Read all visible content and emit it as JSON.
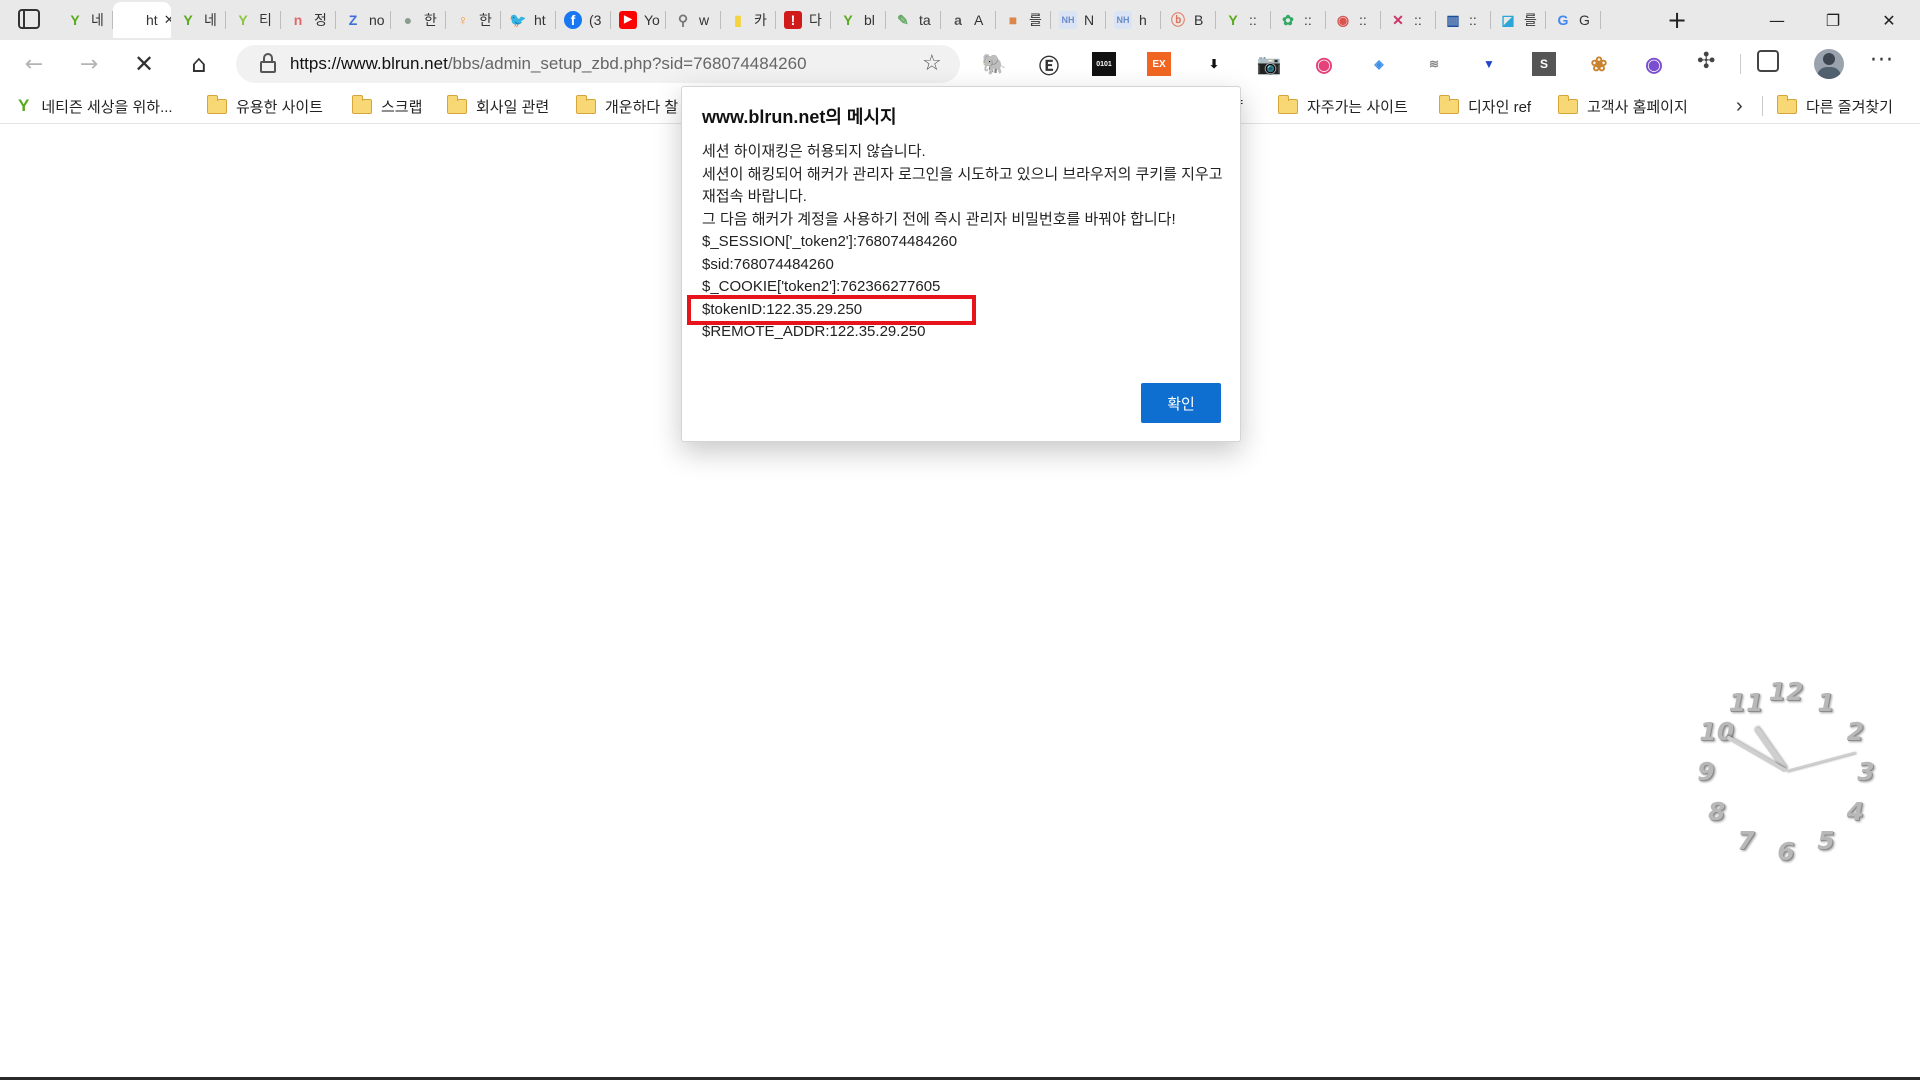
{
  "browser": {
    "tabs": [
      {
        "label": "네",
        "icon": "naver-blog-icon",
        "color": "#5aaa1e",
        "glyph": "Y"
      },
      {
        "label": "ht",
        "icon": "blank-page-icon",
        "color": "#ffffff",
        "glyph": "",
        "active": true,
        "close": "✕"
      },
      {
        "label": "네",
        "icon": "naver-blog-icon",
        "color": "#5aaa1e",
        "glyph": "Y"
      },
      {
        "label": "티",
        "icon": "naver-blog-icon",
        "color": "#8cc63f",
        "glyph": "Y"
      },
      {
        "label": "정",
        "icon": "n-icon",
        "color": "#e0686b",
        "glyph": "n"
      },
      {
        "label": "no",
        "icon": "z-icon",
        "color": "#3e6fd8",
        "glyph": "Z"
      },
      {
        "label": "한",
        "icon": "person-icon",
        "color": "#8c9c8c",
        "glyph": "●"
      },
      {
        "label": "한",
        "icon": "figure-icon",
        "color": "#f39a33",
        "glyph": "♀"
      },
      {
        "label": "ht",
        "icon": "twitter-icon",
        "color": "#1d9bf0",
        "glyph": "🐦"
      },
      {
        "label": "(3",
        "icon": "facebook-icon",
        "color": "#1877f2",
        "glyph": "f"
      },
      {
        "label": "Yo",
        "icon": "youtube-icon",
        "color": "#ff0000",
        "glyph": "▶"
      },
      {
        "label": "w",
        "icon": "link-icon",
        "color": "#777777",
        "glyph": "⚲"
      },
      {
        "label": "카",
        "icon": "note-icon",
        "color": "#f5d33f",
        "glyph": "▮"
      },
      {
        "label": "다",
        "icon": "exclaim-icon",
        "color": "#d11a1a",
        "glyph": "!"
      },
      {
        "label": "bl",
        "icon": "naver-blog-icon",
        "color": "#5aaa1e",
        "glyph": "Y"
      },
      {
        "label": "ta",
        "icon": "pen-icon",
        "color": "#66aa66",
        "glyph": "✎"
      },
      {
        "label": "A",
        "icon": "amazon-icon",
        "color": "#555555",
        "glyph": "a"
      },
      {
        "label": "를",
        "icon": "box-icon",
        "color": "#d9884a",
        "glyph": "■"
      },
      {
        "label": "N",
        "icon": "nh-icon",
        "color": "#6b8cc7",
        "glyph": "NH"
      },
      {
        "label": "h",
        "icon": "nh-icon",
        "color": "#6b8cc7",
        "glyph": "NH"
      },
      {
        "label": "B",
        "icon": "b-icon",
        "color": "#e07a5f",
        "glyph": "ⓑ"
      },
      {
        "label": "::",
        "icon": "naver-blog-icon",
        "color": "#5aaa1e",
        "glyph": "Y"
      },
      {
        "label": "::",
        "icon": "puzzle-color-icon",
        "color": "#33aa66",
        "glyph": "✿"
      },
      {
        "label": "::",
        "icon": "circle-logo-icon",
        "color": "#d9534f",
        "glyph": "◉"
      },
      {
        "label": "::",
        "icon": "cross-logo-icon",
        "color": "#cc3366",
        "glyph": "✕"
      },
      {
        "label": "::",
        "icon": "chart-logo-icon",
        "color": "#1b4f9c",
        "glyph": "▥"
      },
      {
        "label": "를",
        "icon": "map-icon",
        "color": "#2aa7d6",
        "glyph": "◪"
      },
      {
        "label": "G",
        "icon": "google-icon",
        "color": "#4285f4",
        "glyph": "G"
      }
    ],
    "new_tab": "+",
    "window": {
      "minimize": "—",
      "restore": "❐",
      "close": "✕"
    },
    "url": {
      "host": "https://www.blrun.net",
      "path": "/bbs/admin_setup_zbd.php?sid=768074484260"
    },
    "bookmarks": [
      {
        "label": "네티즌 세상을 위하...",
        "icon": "naver-blog-icon"
      },
      {
        "label": "유용한 사이트",
        "icon": "folder-icon"
      },
      {
        "label": "스크랩",
        "icon": "folder-icon"
      },
      {
        "label": "회사일 관련",
        "icon": "folder-icon"
      },
      {
        "label": "개운하다 찰",
        "icon": "folder-icon"
      },
      {
        "label": "ref",
        "icon": "none"
      },
      {
        "label": "자주가는 사이트",
        "icon": "folder-icon"
      },
      {
        "label": "디자인 ref",
        "icon": "folder-icon"
      },
      {
        "label": "고객사 홈페이지",
        "icon": "folder-icon"
      },
      {
        "label": "다른 즐겨찾기",
        "icon": "folder-icon"
      }
    ],
    "extensions": [
      {
        "name": "evernote-icon",
        "glyph": "🐘",
        "color": "#2dbe60"
      },
      {
        "name": "e-circle-icon",
        "glyph": "Ⓔ",
        "color": "#333333"
      },
      {
        "name": "binary-icon",
        "glyph": "0101",
        "color": "#111111"
      },
      {
        "name": "ex-icon",
        "glyph": "EX",
        "color": "#f06522"
      },
      {
        "name": "shield-down-icon",
        "glyph": "⬇",
        "color": "#111111"
      },
      {
        "name": "camera-icon",
        "glyph": "📷",
        "color": "#888888"
      },
      {
        "name": "color-wheel-icon",
        "glyph": "◉",
        "color": "#e5417a"
      },
      {
        "name": "layers-icon",
        "glyph": "◈",
        "color": "#3d8ee8"
      },
      {
        "name": "rss-icon",
        "glyph": "≋",
        "color": "#888888"
      },
      {
        "name": "down-arrow-icon",
        "glyph": "▼",
        "color": "#2244cc"
      },
      {
        "name": "s-box-icon",
        "glyph": "S",
        "color": "#555555"
      },
      {
        "name": "cookie-icon",
        "glyph": "❀",
        "color": "#c9822d"
      },
      {
        "name": "color-ring-icon",
        "glyph": "◉",
        "color": "#7a4fcf"
      }
    ]
  },
  "dialog": {
    "title": "www.blrun.net의 메시지",
    "lines": [
      "세션 하이재킹은 허용되지 않습니다.",
      "세션이 해킹되어 해커가 관리자 로그인을 시도하고 있으니 브라우저의 쿠키를 지우고 재접속 바랍니다.",
      "그 다음 해커가 계정을 사용하기 전에 즉시 관리자 비밀번호를 바꿔야 합니다!",
      "$_SESSION['_token2']:768074484260",
      "$sid:768074484260",
      "$_COOKIE['token2']:762366277605",
      "$tokenID:122.35.29.250",
      "$REMOTE_ADDR:122.35.29.250"
    ],
    "highlight_color": "#e8141b",
    "ok_label": "확인",
    "ok_color": "#0f6fd1"
  },
  "clock": {
    "numbers": [
      "12",
      "1",
      "2",
      "3",
      "4",
      "5",
      "6",
      "7",
      "8",
      "9",
      "10",
      "11"
    ],
    "time": "10:50"
  }
}
